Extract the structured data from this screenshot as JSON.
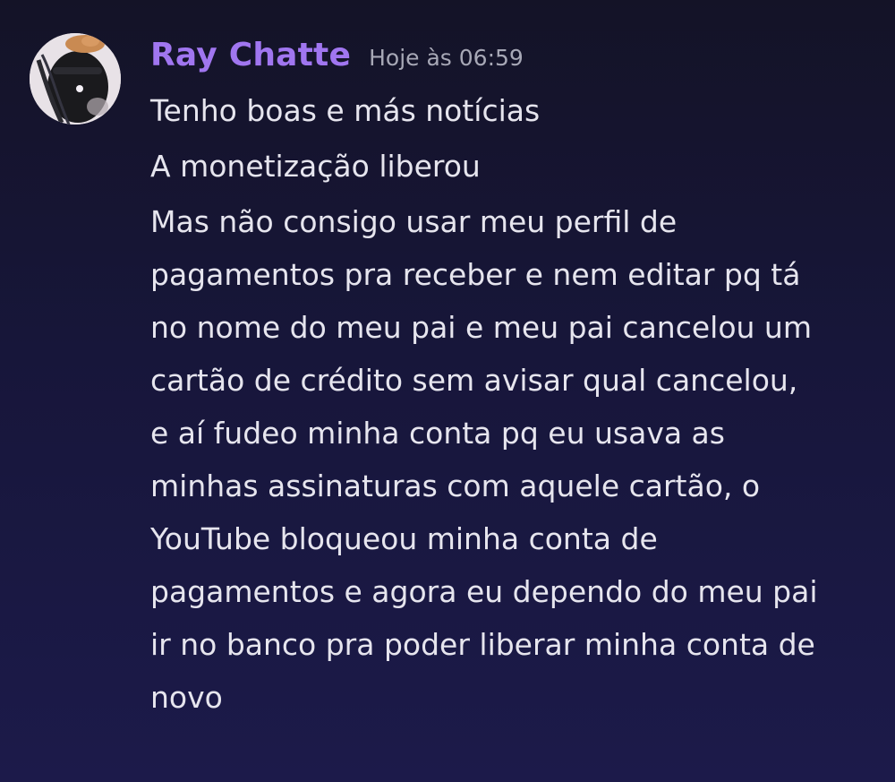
{
  "message": {
    "author": "Ray Chatte",
    "timestamp": "Hoje às 06:59",
    "avatar_icon": "user-avatar-icon",
    "colors": {
      "username": "#a076f0",
      "timestamp": "#a7a8b6",
      "text": "#e6e5ee",
      "background": "#17163a"
    },
    "lines": [
      "Tenho boas e más notícias",
      "A monetização liberou"
    ],
    "paragraph_lines": [
      "Mas não consigo usar meu perfil de",
      "pagamentos pra receber e nem editar pq tá",
      "no nome do meu pai e meu pai cancelou um",
      "cartão de crédito sem avisar qual cancelou,",
      "e aí fudeo minha conta pq eu usava as",
      "minhas assinaturas com aquele cartão, o",
      "YouTube bloqueou minha conta de",
      "pagamentos e agora eu dependo do meu pai",
      "ir no banco pra poder liberar minha conta de",
      "novo"
    ]
  }
}
